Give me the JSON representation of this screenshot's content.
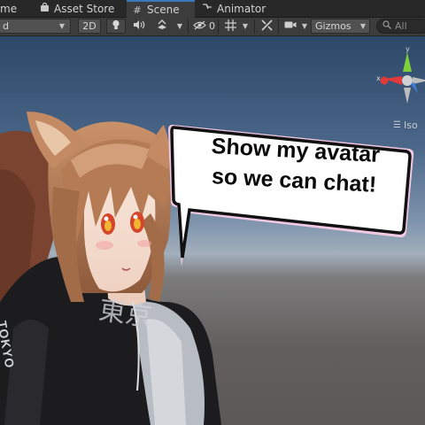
{
  "tabs": [
    {
      "label": "me",
      "icon": ""
    },
    {
      "label": "Asset Store",
      "icon": "shopping-bag-icon"
    },
    {
      "label": "Scene",
      "icon": "hash-icon",
      "active": true
    },
    {
      "label": "Animator",
      "icon": "animator-icon"
    }
  ],
  "toolbar": {
    "shading_mode": "d",
    "mode_2d": "2D",
    "hidden_count": "0",
    "gizmos_label": "Gizmos",
    "search_placeholder": "All"
  },
  "gizmo": {
    "x_label": "x",
    "y_label": "y",
    "projection": "Iso"
  },
  "bubble": {
    "line1": "Show my avatar",
    "line2": "so we can chat!"
  },
  "hoodie": {
    "sleeve_text": "TOKYO",
    "chest_text": "東京"
  },
  "colors": {
    "accent": "#3a79bb",
    "axis_x": "#e03a3a",
    "axis_y": "#7fd13b",
    "axis_z": "#3f7fe0"
  }
}
